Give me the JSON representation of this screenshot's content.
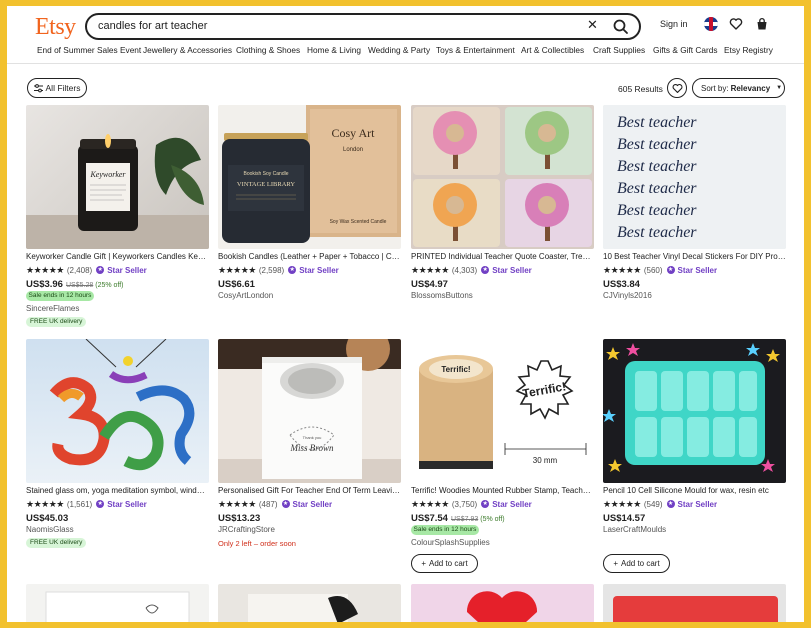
{
  "header": {
    "logo": "Etsy",
    "search_value": "candles for art teacher",
    "sign_in": "Sign in"
  },
  "nav": [
    "End of Summer Sales Event",
    "Jewellery & Accessories",
    "Clothing & Shoes",
    "Home & Living",
    "Wedding & Party",
    "Toys & Entertainment",
    "Art & Collectibles",
    "Craft Supplies",
    "Gifts & Gift Cards",
    "Etsy Registry"
  ],
  "toolbar": {
    "all_filters": "All Filters",
    "results": "605 Results",
    "sort_prefix": "Sort by:",
    "sort_value": "Relevancy"
  },
  "products": [
    {
      "title": "Keyworker Candle Gift | Keyworkers Candles Keyworker Gift",
      "stars": "★★★★★",
      "count": "(2,408)",
      "star_seller": "Star Seller",
      "price": "US$3.96",
      "orig": "US$5.28",
      "disc": "(25% off)",
      "sale": "Sale ends in 12 hours",
      "shop": "SincereFlames",
      "ship": "FREE UK delivery"
    },
    {
      "title": "Bookish Candles (Leather + Paper + Tobacco | Cosy Art",
      "stars": "★★★★★",
      "count": "(2,598)",
      "star_seller": "Star Seller",
      "price": "US$6.61",
      "shop": "CosyArtLondon"
    },
    {
      "title": "PRINTED Individual Teacher Quote Coaster, Tree Design",
      "stars": "★★★★★",
      "count": "(4,303)",
      "star_seller": "Star Seller",
      "price": "US$4.97",
      "shop": "BlossomsButtons"
    },
    {
      "title": "10 Best Teacher Vinyl Decal Stickers For DIY Projects",
      "stars": "★★★★★",
      "count": "(560)",
      "star_seller": "Star Seller",
      "price": "US$3.84",
      "shop": "CJVinyls2016"
    },
    {
      "title": "Stained glass om, yoga meditation symbol, window hanging",
      "stars": "★★★★★",
      "count": "(1,561)",
      "star_seller": "Star Seller",
      "price": "US$45.03",
      "shop": "NaomisGlass",
      "ship": "FREE UK delivery"
    },
    {
      "title": "Personalised Gift For Teacher End Of Term Leaving Gift",
      "stars": "★★★★★",
      "count": "(487)",
      "star_seller": "Star Seller",
      "price": "US$13.23",
      "shop": "JRCraftingStore",
      "note": "Only 2 left – order soon"
    },
    {
      "title": "Terrific! Woodies Mounted Rubber Stamp, Teacher Stamp",
      "stars": "★★★★★",
      "count": "(3,750)",
      "star_seller": "Star Seller",
      "price": "US$7.54",
      "orig": "US$7.93",
      "disc": "(5% off)",
      "sale": "Sale ends in 12 hours",
      "shop": "ColourSplashSupplies",
      "cart": "Add to cart"
    },
    {
      "title": "Pencil 10 Cell Silicone Mould for wax, resin etc",
      "stars": "★★★★★",
      "count": "(549)",
      "star_seller": "Star Seller",
      "price": "US$14.57",
      "shop": "LaserCraftMoulds",
      "cart": "Add to cart"
    }
  ],
  "images": {
    "keyworker_label": "Keyworker",
    "bookish_label": "Bookish Soy Candle",
    "vintage_label": "VINTAGE LIBRARY",
    "cosy_art": "Cosy Art",
    "london": "London",
    "soy_wax": "Soy Wax Scented Candle",
    "best_teacher": "Best teacher",
    "stamp_word": "Terrific!",
    "stamp_size": "30 mm",
    "miss_brown": "Miss Brown",
    "thank_you": "Thank you"
  }
}
